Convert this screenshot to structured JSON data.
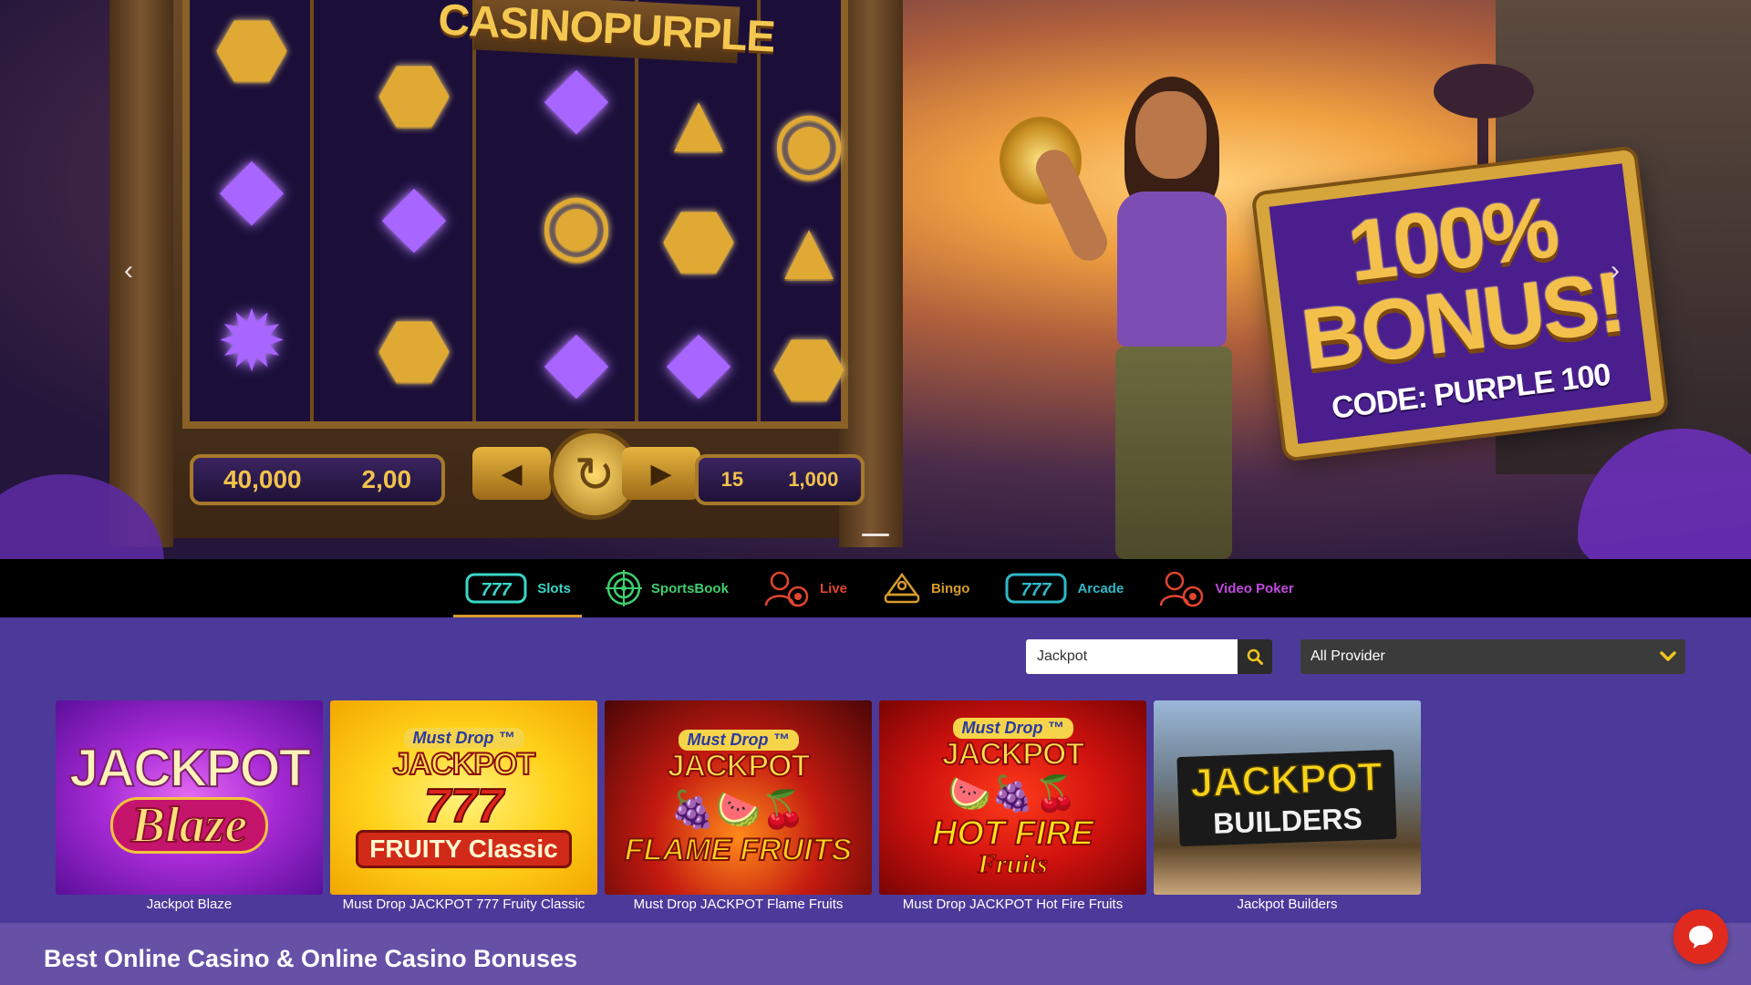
{
  "hero": {
    "brand": "CASINOPURPLE",
    "bonus_line1": "100%",
    "bonus_line2": "BONUS!",
    "bonus_code": "CODE: PURPLE 100",
    "panel_left_value1": "40,000",
    "panel_left_value2": "2,00",
    "panel_right_value1": "15",
    "panel_right_value2": "1,000",
    "prev_arrow": "‹",
    "next_arrow": "›",
    "slides_total": 1,
    "slide_active": 1
  },
  "categories": [
    {
      "label": "Slots",
      "icon": "slot-777-icon",
      "color": "#3ad6c8",
      "active": true
    },
    {
      "label": "SportsBook",
      "icon": "target-icon",
      "color": "#3ecf6e",
      "active": false
    },
    {
      "label": "Live",
      "icon": "live-dealer-icon",
      "color": "#e2452f",
      "active": false
    },
    {
      "label": "Bingo",
      "icon": "bingo-icon",
      "color": "#d79b2c",
      "active": false
    },
    {
      "label": "Arcade",
      "icon": "arcade-777-icon",
      "color": "#2fb9c9",
      "active": false
    },
    {
      "label": "Video Poker",
      "icon": "video-poker-icon",
      "color": "#c14ae0",
      "active": false
    }
  ],
  "filters": {
    "search_value": "Jackpot",
    "search_placeholder": "Search",
    "provider_selected": "All Provider"
  },
  "games": [
    {
      "name": "Jackpot Blaze",
      "art_line1": "JACKPOT",
      "art_line2": "Blaze"
    },
    {
      "name": "Must Drop JACKPOT 777 Fruity Classic",
      "badge": "Must Drop ™",
      "art_line1": "JACKPOT",
      "art_line2": "777",
      "art_line3": "FRUITY Classic"
    },
    {
      "name": "Must Drop JACKPOT Flame Fruits",
      "badge": "Must Drop ™",
      "art_line1": "JACKPOT",
      "art_line2": "FLAME FRUITS"
    },
    {
      "name": "Must Drop JACKPOT Hot Fire Fruits",
      "badge": "Must Drop ™",
      "art_line1": "JACKPOT",
      "art_line2": "HOT FIRE",
      "art_line3": "Fruits"
    },
    {
      "name": "Jackpot Builders",
      "art_line1": "JACKPOT",
      "art_line2": "BUILDERS"
    }
  ],
  "footer": {
    "title": "Best Online Casino & Online Casino Bonuses"
  },
  "chat": {
    "icon": "chat-bubble-icon"
  }
}
